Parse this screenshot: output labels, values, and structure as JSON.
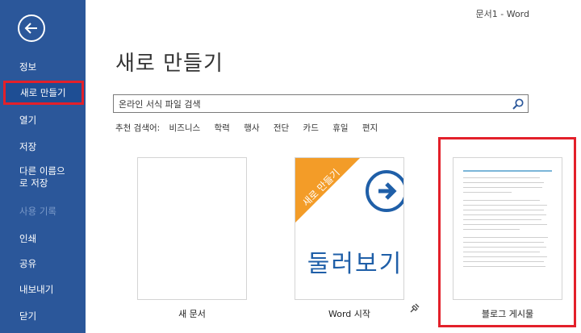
{
  "window": {
    "title": "문서1  -  Word"
  },
  "sidebar": {
    "items": [
      {
        "label": "정보"
      },
      {
        "label": "새로 만들기"
      },
      {
        "label": "열기"
      },
      {
        "label": "저장"
      },
      {
        "label": "다른 이름으로 저장"
      },
      {
        "label": "사용 기록"
      },
      {
        "label": "인쇄"
      },
      {
        "label": "공유"
      },
      {
        "label": "내보내기"
      },
      {
        "label": "닫기"
      }
    ]
  },
  "main": {
    "title": "새로 만들기",
    "search": {
      "value": "온라인 서식 파일 검색"
    },
    "suggested": {
      "label": "추천 검색어:",
      "tags": [
        "비즈니스",
        "학력",
        "행사",
        "전단",
        "카드",
        "휴일",
        "편지"
      ]
    },
    "templates": [
      {
        "label": "새 문서"
      },
      {
        "label": "Word 시작",
        "banner": "새로 만들기",
        "preview_text": "둘러보기"
      },
      {
        "label": "블로그 게시물"
      }
    ]
  },
  "colors": {
    "sidebar": "#2b579a",
    "accent": "#f39c28",
    "highlight": "#e3202a",
    "brand_blue": "#1f5fa8"
  },
  "icons": [
    "back-arrow-icon",
    "search-icon",
    "arrow-right-icon",
    "pin-icon"
  ]
}
